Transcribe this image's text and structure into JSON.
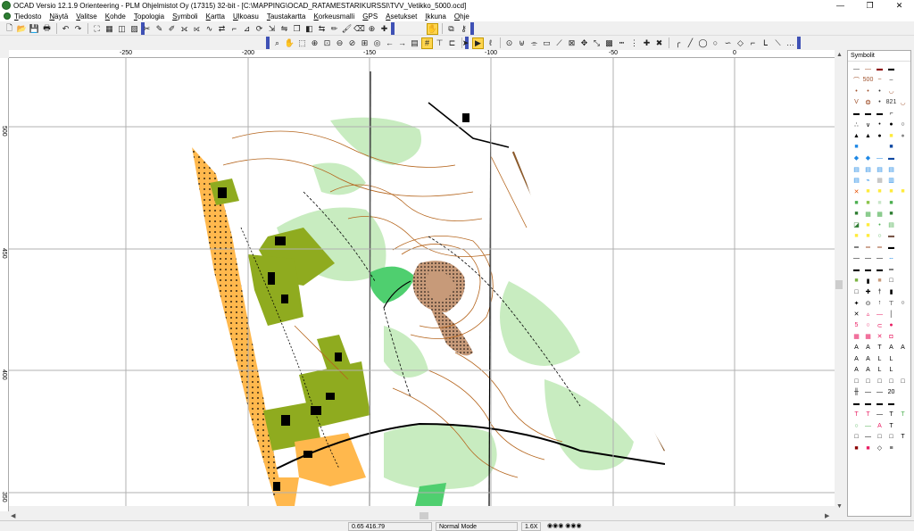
{
  "window": {
    "title": "OCAD Versio 12.1.9  Orienteering - PLM Ohjelmistot Oy (17315) 32-bit - [C:\\MAPPING\\OCAD_RATAMESTARIKURSSI\\TVV_Vetikko_5000.ocd]",
    "minimize": "—",
    "restore": "❐",
    "close": "✕"
  },
  "menu": [
    "Tiedosto",
    "Näytä",
    "Valitse",
    "Kohde",
    "Topologia",
    "Symboli",
    "Kartta",
    "Ulkoasu",
    "Taustakartta",
    "Korkeusmalli",
    "GPS",
    "Asetukset",
    "Ikkuna",
    "Ohje"
  ],
  "ruler": {
    "x_labels": [
      "-250",
      "-200",
      "-150",
      "-100",
      "-50",
      "0"
    ],
    "y_labels": [
      "500",
      "450",
      "400",
      "350"
    ]
  },
  "symbol_panel": {
    "title": "Symbolit"
  },
  "status": {
    "coordinates": "0.65   416.79",
    "mode": "Normal Mode",
    "zoom": "1.6X"
  },
  "colors": {
    "yellow_open": "#ffb84d",
    "rough_open": "#ffe0a6",
    "green_light": "#c8ecc0",
    "green_mid": "#4fcf6f",
    "olive": "#8fab1f",
    "contour": "#b5651d",
    "track": "#000000",
    "grid": "#b0b0b0",
    "earth": "#c79a79"
  }
}
